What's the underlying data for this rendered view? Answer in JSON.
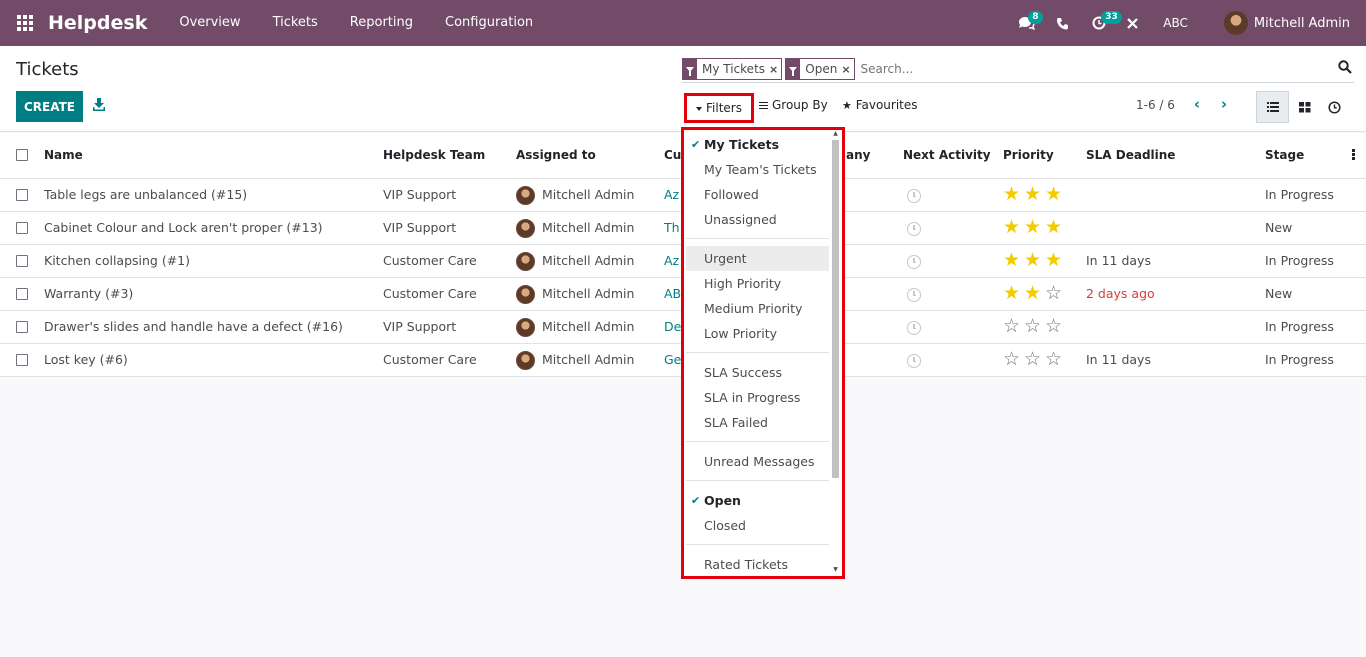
{
  "navbar": {
    "brand": "Helpdesk",
    "menu": [
      "Overview",
      "Tickets",
      "Reporting",
      "Configuration"
    ],
    "messages_badge": "8",
    "activities_badge": "33",
    "company": "ABC",
    "user": "Mitchell Admin"
  },
  "control_panel": {
    "title": "Tickets",
    "create_label": "CREATE",
    "facets": [
      "My Tickets",
      "Open"
    ],
    "facet_remove": "×",
    "search_placeholder": "Search...",
    "filters_label": "Filters",
    "groupby_label": "Group By",
    "favourites_label": "Favourites",
    "pager": "1-6 / 6"
  },
  "table": {
    "headers": {
      "name": "Name",
      "team": "Helpdesk Team",
      "assigned": "Assigned to",
      "customer": "Cu",
      "company": "any",
      "next_activity": "Next Activity",
      "priority": "Priority",
      "sla": "SLA Deadline",
      "stage": "Stage"
    },
    "rows": [
      {
        "name": "Table legs are unbalanced (#15)",
        "team": "VIP Support",
        "assigned": "Mitchell Admin",
        "customer": "Az",
        "priority": 3,
        "sla": "",
        "stage": "In Progress"
      },
      {
        "name": "Cabinet Colour and Lock aren't proper (#13)",
        "team": "VIP Support",
        "assigned": "Mitchell Admin",
        "customer": "Th",
        "priority": 3,
        "sla": "",
        "stage": "New"
      },
      {
        "name": "Kitchen collapsing (#1)",
        "team": "Customer Care",
        "assigned": "Mitchell Admin",
        "customer": "Az",
        "priority": 3,
        "sla": "In 11 days",
        "stage": "In Progress"
      },
      {
        "name": "Warranty (#3)",
        "team": "Customer Care",
        "assigned": "Mitchell Admin",
        "customer": "AB",
        "priority": 2,
        "sla": "2 days ago",
        "stage": "New"
      },
      {
        "name": "Drawer's slides and handle have a defect (#16)",
        "team": "VIP Support",
        "assigned": "Mitchell Admin",
        "customer": "De",
        "priority": 0,
        "sla": "",
        "stage": "In Progress"
      },
      {
        "name": "Lost key (#6)",
        "team": "Customer Care",
        "assigned": "Mitchell Admin",
        "customer": "Ge",
        "priority": 0,
        "sla": "In 11 days",
        "stage": "In Progress"
      }
    ]
  },
  "filters_menu": {
    "groups": [
      [
        {
          "label": "My Tickets",
          "checked": true
        },
        {
          "label": "My Team's Tickets"
        },
        {
          "label": "Followed"
        },
        {
          "label": "Unassigned"
        }
      ],
      [
        {
          "label": "Urgent",
          "hover": true
        },
        {
          "label": "High Priority"
        },
        {
          "label": "Medium Priority"
        },
        {
          "label": "Low Priority"
        }
      ],
      [
        {
          "label": "SLA Success"
        },
        {
          "label": "SLA in Progress"
        },
        {
          "label": "SLA Failed"
        }
      ],
      [
        {
          "label": "Unread Messages"
        }
      ],
      [
        {
          "label": "Open",
          "checked": true
        },
        {
          "label": "Closed"
        }
      ],
      [
        {
          "label": "Rated Tickets"
        }
      ]
    ]
  },
  "colors": {
    "navbar": "#714b67",
    "primary": "#017e84",
    "highlight_border": "#e3000b",
    "star": "#f3cc00",
    "overdue": "#d23f3a"
  }
}
